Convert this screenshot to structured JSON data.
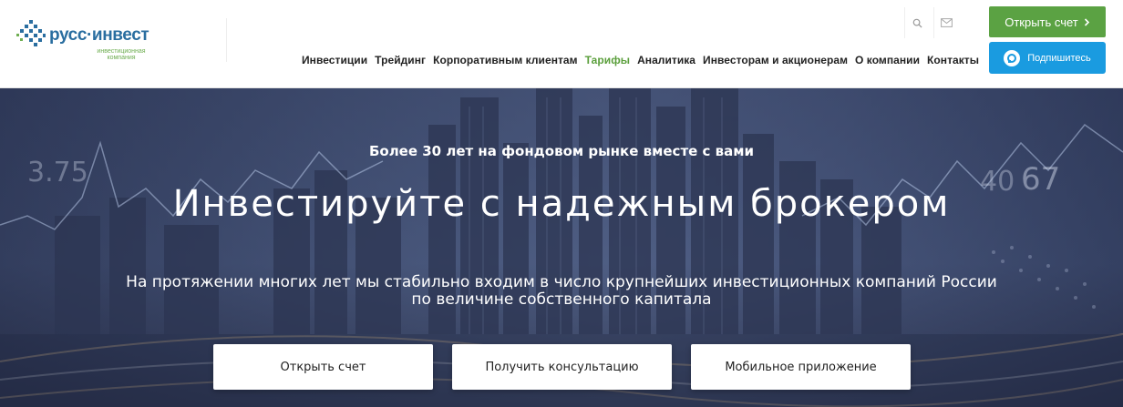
{
  "brand": {
    "name": "русс·инвест",
    "tagline_line1": "инвестиционная",
    "tagline_line2": "компания",
    "primary_color": "#2a6ea0",
    "accent_color": "#5ba243"
  },
  "nav": {
    "items": [
      {
        "label": "Инвестиции"
      },
      {
        "label": "Трейдинг"
      },
      {
        "label": "Корпоративным клиентам"
      },
      {
        "label": "Тарифы",
        "active": true
      },
      {
        "label": "Аналитика"
      },
      {
        "label": "Инвесторам и акционерам"
      },
      {
        "label": "О компании"
      },
      {
        "label": "Контакты"
      }
    ]
  },
  "header_actions": {
    "open_account_label": "Открыть счет",
    "subscribe_label": "Подпишитесь",
    "search_icon": "search-icon",
    "mail_icon": "mail-icon"
  },
  "hero": {
    "kicker": "Более 30 лет на фондовом рынке вместе с вами",
    "title": "Инвестируйте с надежным брокером",
    "description_line1": "На протяжении многих лет мы стабильно входим в число крупнейших инвестиционных компаний России",
    "description_line2": "по величине собственного капитала",
    "buttons": [
      {
        "label": "Открыть счет"
      },
      {
        "label": "Получить консультацию"
      },
      {
        "label": "Мобильное приложение"
      }
    ],
    "overlay_numbers": [
      "3.75",
      "40",
      "67"
    ]
  }
}
